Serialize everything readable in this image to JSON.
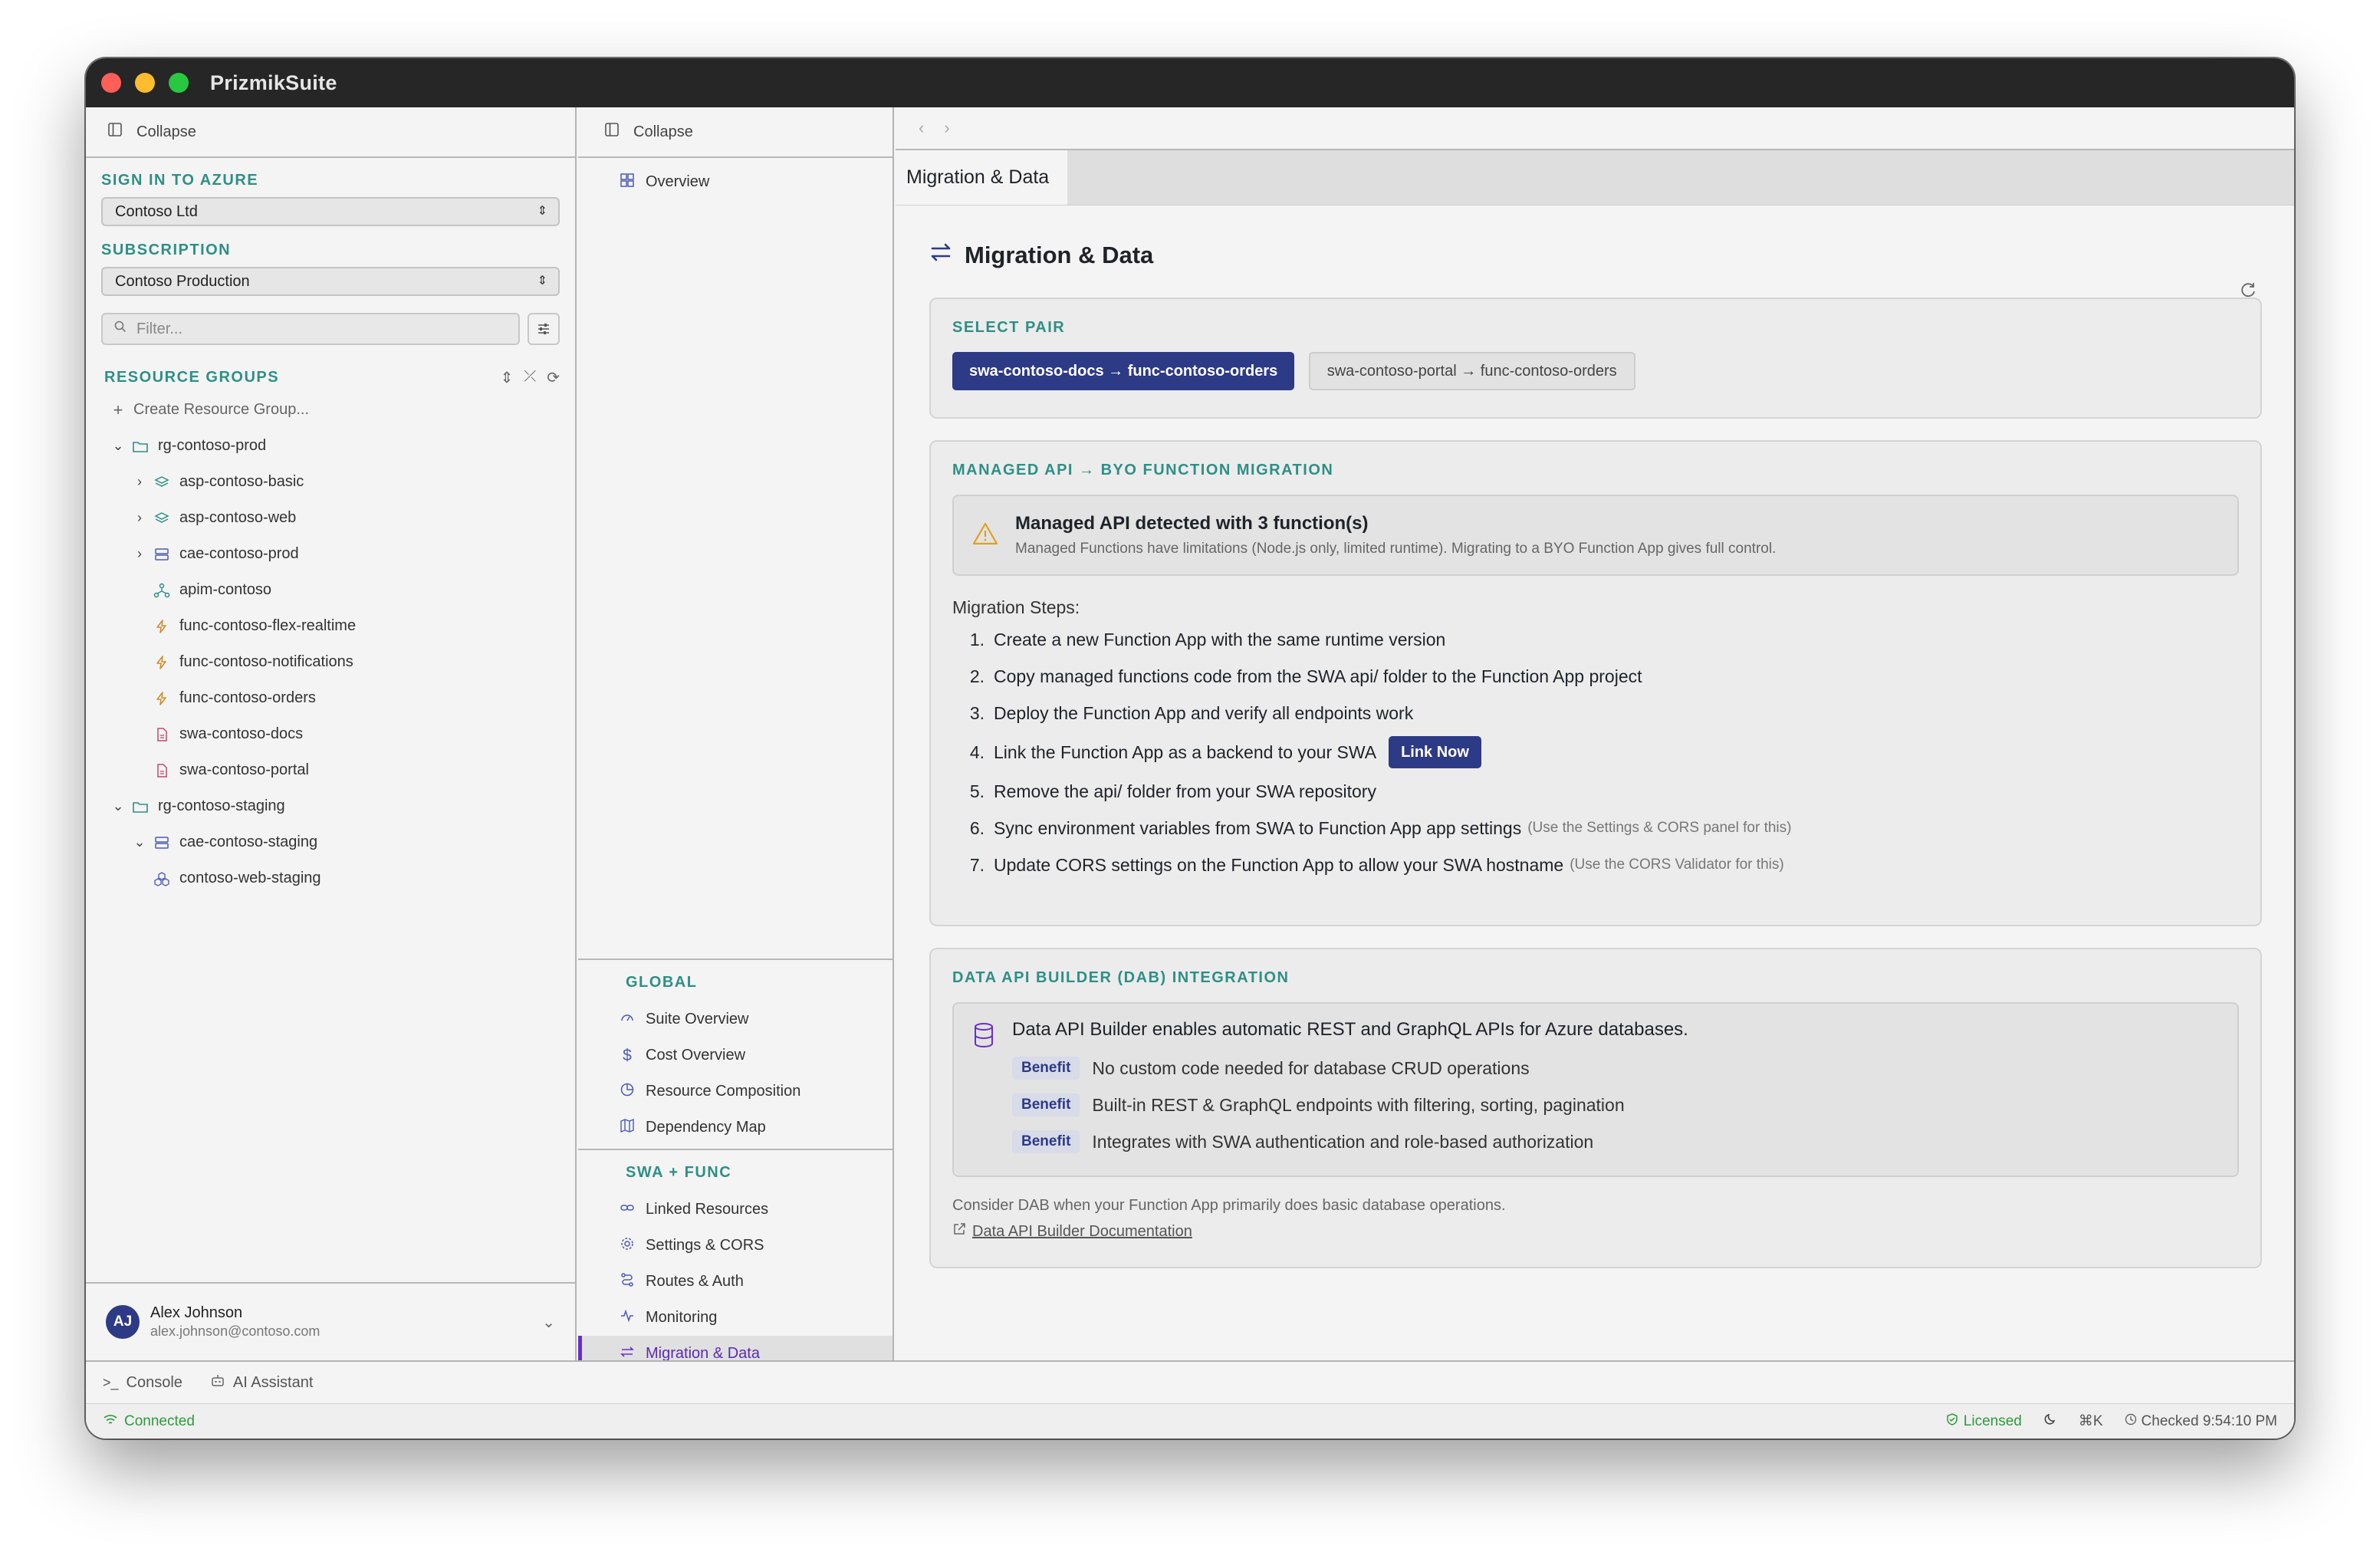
{
  "app": {
    "title": "PrizmikSuite"
  },
  "sidebar": {
    "collapse_label": "Collapse",
    "sign_in_label": "SIGN IN TO AZURE",
    "tenant": "Contoso Ltd",
    "subscription_label": "SUBSCRIPTION",
    "subscription": "Contoso Production",
    "filter_placeholder": "Filter...",
    "resource_groups_label": "RESOURCE GROUPS",
    "create_rg": "Create Resource Group...",
    "tree": [
      {
        "label": "rg-contoso-prod",
        "icon": "folder-icon"
      },
      {
        "label": "asp-contoso-basic",
        "icon": "layers-icon"
      },
      {
        "label": "asp-contoso-web",
        "icon": "layers-icon"
      },
      {
        "label": "cae-contoso-prod",
        "icon": "server-icon"
      },
      {
        "label": "apim-contoso",
        "icon": "network-icon"
      },
      {
        "label": "func-contoso-flex-realtime",
        "icon": "bolt-icon"
      },
      {
        "label": "func-contoso-notifications",
        "icon": "bolt-icon"
      },
      {
        "label": "func-contoso-orders",
        "icon": "bolt-icon"
      },
      {
        "label": "swa-contoso-docs",
        "icon": "file-icon"
      },
      {
        "label": "swa-contoso-portal",
        "icon": "file-icon"
      },
      {
        "label": "rg-contoso-staging",
        "icon": "folder-icon"
      },
      {
        "label": "cae-contoso-staging",
        "icon": "server-icon"
      },
      {
        "label": "contoso-web-staging",
        "icon": "cluster-icon"
      }
    ],
    "user": {
      "initials": "AJ",
      "name": "Alex Johnson",
      "email": "alex.johnson@contoso.com"
    }
  },
  "midnav": {
    "collapse_label": "Collapse",
    "overview": "Overview",
    "global_label": "GLOBAL",
    "global_items": [
      "Suite Overview",
      "Cost Overview",
      "Resource Composition",
      "Dependency Map"
    ],
    "swa_label": "SWA + FUNC",
    "swa_items": [
      "Linked Resources",
      "Settings & CORS",
      "Routes & Auth",
      "Monitoring",
      "Migration & Data"
    ]
  },
  "main": {
    "tab": "Migration & Data",
    "title": "Migration & Data",
    "select_pair": {
      "label": "SELECT PAIR",
      "pairs": [
        "swa-contoso-docs → func-contoso-orders",
        "swa-contoso-portal → func-contoso-orders"
      ]
    },
    "migration": {
      "label": "MANAGED API → BYO FUNCTION MIGRATION",
      "alert_title": "Managed API detected with 3 function(s)",
      "alert_desc": "Managed Functions have limitations (Node.js only, limited runtime). Migrating to a BYO Function App gives full control.",
      "steps_title": "Migration Steps:",
      "steps": [
        {
          "num": "1.",
          "text": "Create a new Function App with the same runtime version",
          "hint": ""
        },
        {
          "num": "2.",
          "text": "Copy managed functions code from the SWA api/ folder to the Function App project",
          "hint": ""
        },
        {
          "num": "3.",
          "text": "Deploy the Function App and verify all endpoints work",
          "hint": ""
        },
        {
          "num": "4.",
          "text": "Link the Function App as a backend to your SWA",
          "hint": ""
        },
        {
          "num": "5.",
          "text": "Remove the api/ folder from your SWA repository",
          "hint": ""
        },
        {
          "num": "6.",
          "text": "Sync environment variables from SWA to Function App app settings",
          "hint": "(Use the Settings & CORS panel for this)"
        },
        {
          "num": "7.",
          "text": "Update CORS settings on the Function App to allow your SWA hostname",
          "hint": "(Use the CORS Validator for this)"
        }
      ],
      "link_now": "Link Now"
    },
    "dab": {
      "label": "DATA API BUILDER (DAB) INTEGRATION",
      "headline": "Data API Builder enables automatic REST and GraphQL APIs for Azure databases.",
      "badge": "Benefit",
      "benefits": [
        "No custom code needed for database CRUD operations",
        "Built-in REST & GraphQL endpoints with filtering, sorting, pagination",
        "Integrates with SWA authentication and role-based authorization"
      ],
      "consider": "Consider DAB when your Function App primarily does basic database operations.",
      "doc_link": "Data API Builder Documentation"
    }
  },
  "bottom": {
    "console": "Console",
    "ai_assistant": "AI Assistant",
    "connected": "Connected",
    "licensed": "Licensed",
    "shortcut": "⌘K",
    "checked": "Checked 9:54:10 PM"
  },
  "colors": {
    "accent": "#2d3a86",
    "teal": "#2f8f86",
    "active_nav": "#6a2fc8",
    "success": "#2f9a3b"
  }
}
